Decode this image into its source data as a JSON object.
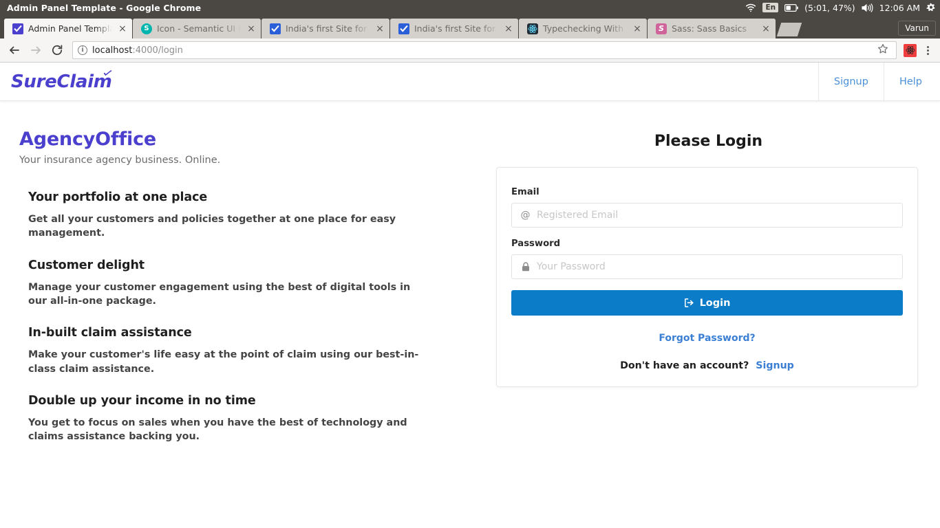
{
  "os": {
    "window_title": "Admin Panel Template - Google Chrome",
    "tray": {
      "wifi_icon": "wifi-icon",
      "language": "En",
      "battery_icon": "battery-icon",
      "battery_status": "(5:01, 47%)",
      "volume_icon": "volume-icon",
      "clock": "12:06 AM",
      "settings_icon": "gear-icon"
    }
  },
  "browser": {
    "tabs": [
      {
        "title": "Admin Panel Template",
        "favicon": "checkbox-purple-icon",
        "active": true,
        "close_label": "×"
      },
      {
        "title": "Icon - Semantic UI R",
        "favicon": "semantic-ui-icon",
        "active": false,
        "close_label": "×"
      },
      {
        "title": "India's first Site for",
        "favicon": "checkbox-blue-icon",
        "active": false,
        "close_label": "×"
      },
      {
        "title": "India's first Site for",
        "favicon": "checkbox-blue-icon",
        "active": false,
        "close_label": "×"
      },
      {
        "title": "Typechecking With",
        "favicon": "react-icon",
        "active": false,
        "close_label": "×"
      },
      {
        "title": "Sass: Sass Basics",
        "favicon": "sass-icon",
        "active": false,
        "close_label": "×"
      }
    ],
    "new_tab_label": "",
    "profile_label": "Varun",
    "toolbar": {
      "back_icon": "back-arrow-icon",
      "forward_icon": "forward-arrow-icon",
      "reload_icon": "reload-icon",
      "site_info_icon": "info-icon",
      "url_host": "localhost",
      "url_path": ":4000/login",
      "url_full": "localhost:4000/login",
      "bookmark_icon": "star-icon",
      "extension_icon": "react-devtools-icon",
      "menu_icon": "three-dots-menu-icon"
    }
  },
  "site": {
    "brand": "SureClaim",
    "nav": [
      {
        "label": "Signup"
      },
      {
        "label": "Help"
      }
    ]
  },
  "hero": {
    "title": "AgencyOffice",
    "subtitle": "Your insurance agency business. Online.",
    "features": [
      {
        "heading": "Your portfolio at one place",
        "body": "Get all your customers and policies together at one place for easy management."
      },
      {
        "heading": "Customer delight",
        "body": "Manage your customer engagement using the best of digital tools in our all-in-one package."
      },
      {
        "heading": "In-built claim assistance",
        "body": "Make your customer's life easy at the point of claim using our best-in-class claim assistance."
      },
      {
        "heading": "Double up your income in no time",
        "body": "You get to focus on sales when you have the best of technology and claims assistance backing you."
      }
    ]
  },
  "login": {
    "heading": "Please Login",
    "email": {
      "label": "Email",
      "placeholder": "Registered Email",
      "value": "",
      "icon": "at-sign-icon"
    },
    "password": {
      "label": "Password",
      "placeholder": "Your Password",
      "value": "",
      "icon": "lock-icon"
    },
    "submit_label": "Login",
    "submit_icon": "sign-in-icon",
    "forgot_label": "Forgot Password?",
    "no_account_text": "Don't have an account?",
    "signup_label": "Signup"
  },
  "colors": {
    "brand_purple": "#4b3fce",
    "link_blue": "#3b7fd4",
    "nav_link_blue": "#4a90d9",
    "button_blue": "#0a7cc8",
    "os_bar": "#4b4844",
    "tab_inactive": "#d4d1cc",
    "tab_active": "#f6f5f4"
  }
}
